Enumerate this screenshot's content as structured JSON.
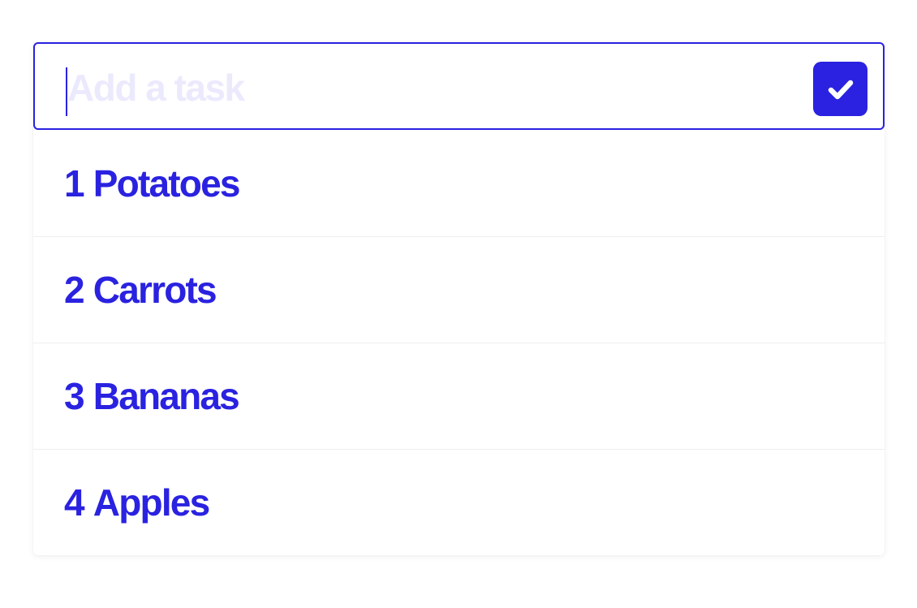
{
  "task_input": {
    "placeholder": "Add a task",
    "value": ""
  },
  "submit_button": {
    "icon": "checkmark-icon"
  },
  "tasks": [
    {
      "number": "1",
      "label": "Potatoes"
    },
    {
      "number": "2",
      "label": "Carrots"
    },
    {
      "number": "3",
      "label": "Bananas"
    },
    {
      "number": "4",
      "label": "Apples"
    }
  ],
  "colors": {
    "accent": "#2a22e0",
    "placeholder": "#ebeafd",
    "divider": "#eeeeee",
    "background": "#ffffff"
  }
}
